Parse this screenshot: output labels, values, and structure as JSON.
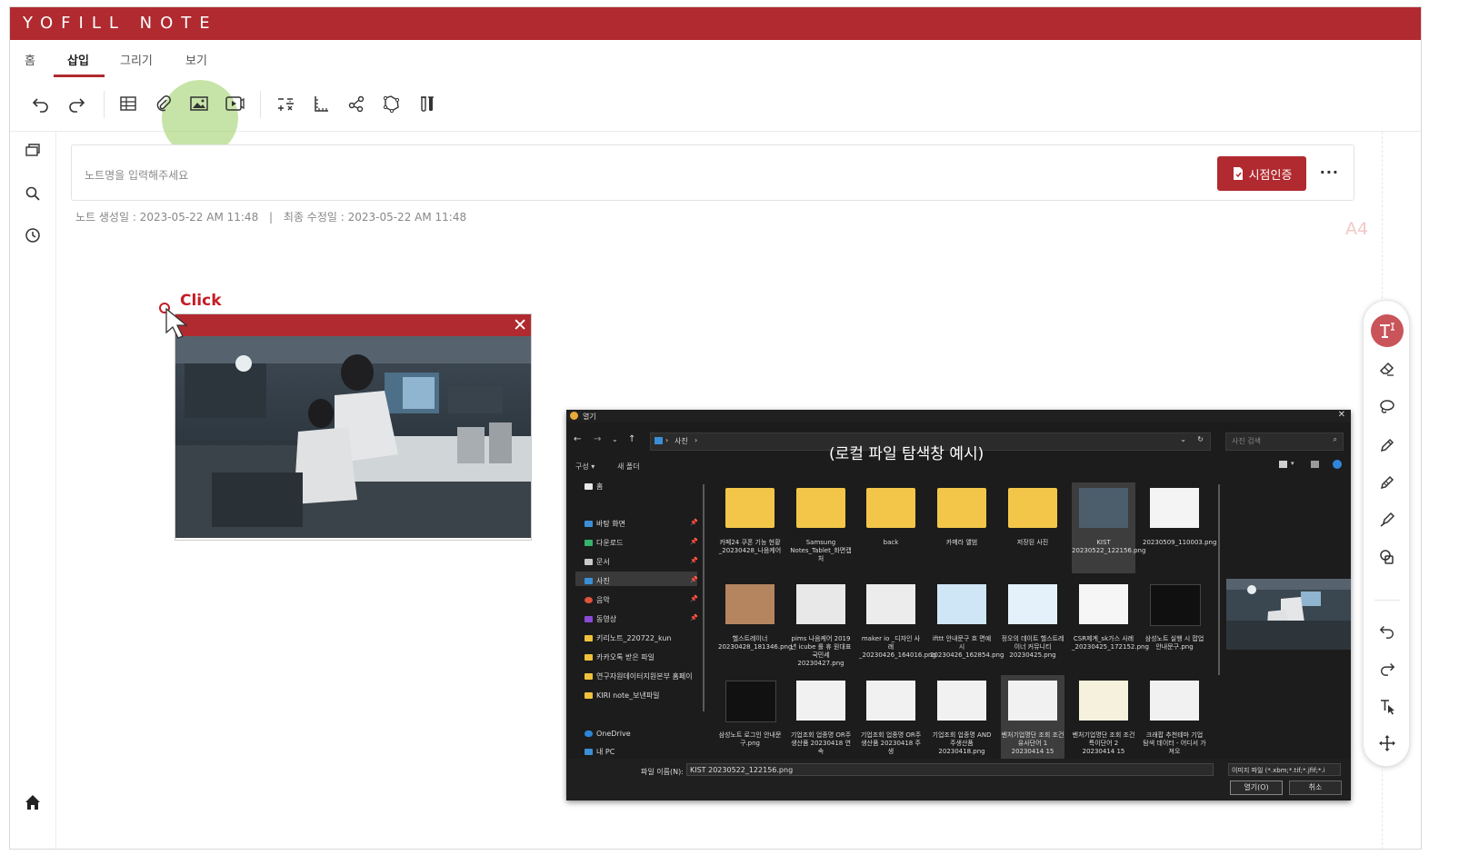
{
  "app": {
    "title": "YOFILL NOTE"
  },
  "tabs": [
    {
      "label": "홈"
    },
    {
      "label": "삽입"
    },
    {
      "label": "그리기"
    },
    {
      "label": "보기"
    }
  ],
  "active_tab": "삽입",
  "toolbar": {
    "buttons": [
      "undo-icon",
      "redo-icon",
      "table-icon",
      "attach-icon",
      "image-icon",
      "video-icon",
      "formula-icon",
      "ruler-icon",
      "share-icon",
      "shapes-icon",
      "tubes-icon"
    ]
  },
  "note": {
    "name_placeholder": "노트명을 입력해주세요",
    "cert_button": "시점인증",
    "more": "···",
    "created": "노트 생성일 : 2023-05-22 AM 11:48",
    "separator": "|",
    "modified": "최종 수정일 : 2023-05-22 AM 11:48",
    "page_size": "A4"
  },
  "annotation": {
    "click_label": "Click"
  },
  "image_frame": {
    "close": "✕"
  },
  "explorer": {
    "title": "열기",
    "path": "사진",
    "search_placeholder": "사진 검색",
    "caption": "(로컬 파일 탐색창 예시)",
    "cmd_organize": "구성 ▾",
    "cmd_new_folder": "새 폴더",
    "nav": [
      {
        "label": "홈"
      },
      {
        "label": "바탕 화면"
      },
      {
        "label": "다운로드"
      },
      {
        "label": "문서"
      },
      {
        "label": "사진"
      },
      {
        "label": "음악"
      },
      {
        "label": "동영상"
      },
      {
        "label": "키리노트_220722_kun"
      },
      {
        "label": "카카오톡 받은 파일"
      },
      {
        "label": "연구자원데이터지원본부 홈페이"
      },
      {
        "label": "KIRI note_보낸파일"
      },
      {
        "label": "OneDrive"
      },
      {
        "label": "내 PC"
      }
    ],
    "files": [
      "카페24 쿠폰 기능 현황_20230428_나음케어",
      "Samsung Notes_Tablet_화면캡처",
      "back",
      "카메라 앨범",
      "저장된 사진",
      "KIST 20230522_122156.png",
      "20230509_110003.png",
      "헬스트레이너 20230428_181346.png",
      "pims 나음케어 2019년 icube 롤 휴 원대표 국민세 20230427.png",
      "maker io _디자인 사례 _20230426_164016.png",
      "ifttt 안내문구 흐 면예시 20230426_162854.png",
      "정오의 데이트 헬스트레이너 커뮤니티 20230425.png",
      "CSR제계_sk가스 사례 _20230425_172152.png",
      "삼성노트 실행 시 팝업 안내문구.png",
      "삼성노트 로그인 안내문구.png",
      "기업조회 업종명 OR주생산품 20230418 연속",
      "기업조회 업종명 OR주생산품 20230418 주생",
      "기업조회 업종명 AND주생산품 20230418.png",
      "벤처기업명단 조회 조건 유사단어 1 20230414 15",
      "벤처기업명단 조회 조건 특이단어 2 20230414 15",
      "크래팝 추천테마 기업 탐색 데이터 - 어디서 가져오"
    ],
    "filename_label": "파일 이름(N):",
    "filename_value": "KIST 20230522_122156.png",
    "filetype": "이미지 파일 (*.xbm;*.tif;*.jfif;*.i",
    "open_button": "열기(O)",
    "cancel_button": "취소"
  },
  "colors": {
    "brand": "#b02a2f",
    "tool_active": "#c9545a"
  }
}
